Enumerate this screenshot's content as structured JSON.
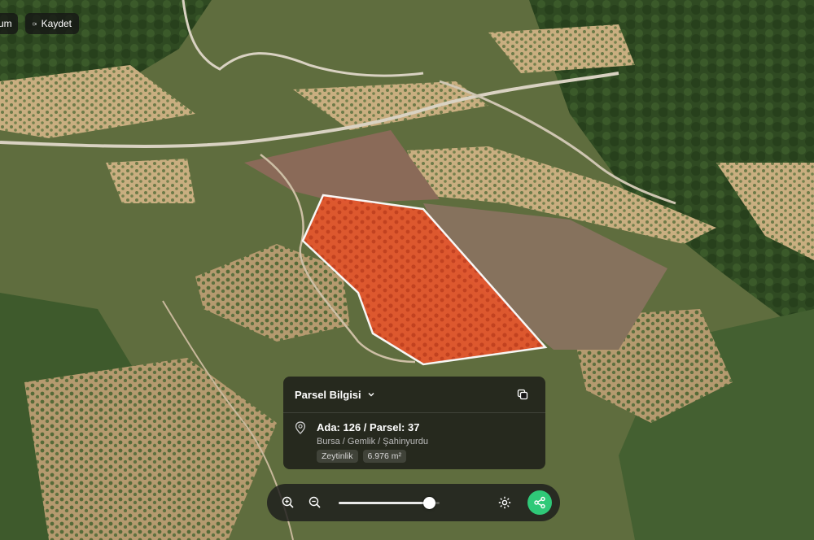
{
  "toolbar": {
    "konum_label": "um",
    "kaydet_label": "Kaydet"
  },
  "parcel_panel": {
    "title": "Parsel Bilgisi",
    "parcel_id": "Ada: 126 / Parsel: 37",
    "location": "Bursa / Gemlik / Şahinyurdu",
    "land_type": "Zeytinlik",
    "area": "6.976 m²"
  },
  "map_controls": {
    "zoom_level_fraction": 0.9,
    "zoom_in_icon": "zoom-in-icon",
    "zoom_out_icon": "zoom-out-icon",
    "settings_icon": "gear-icon",
    "share_icon": "share-icon"
  },
  "colors": {
    "parcel_fill": "#e4572e",
    "parcel_outline": "#ffffff",
    "share_accent": "#2fc978"
  }
}
